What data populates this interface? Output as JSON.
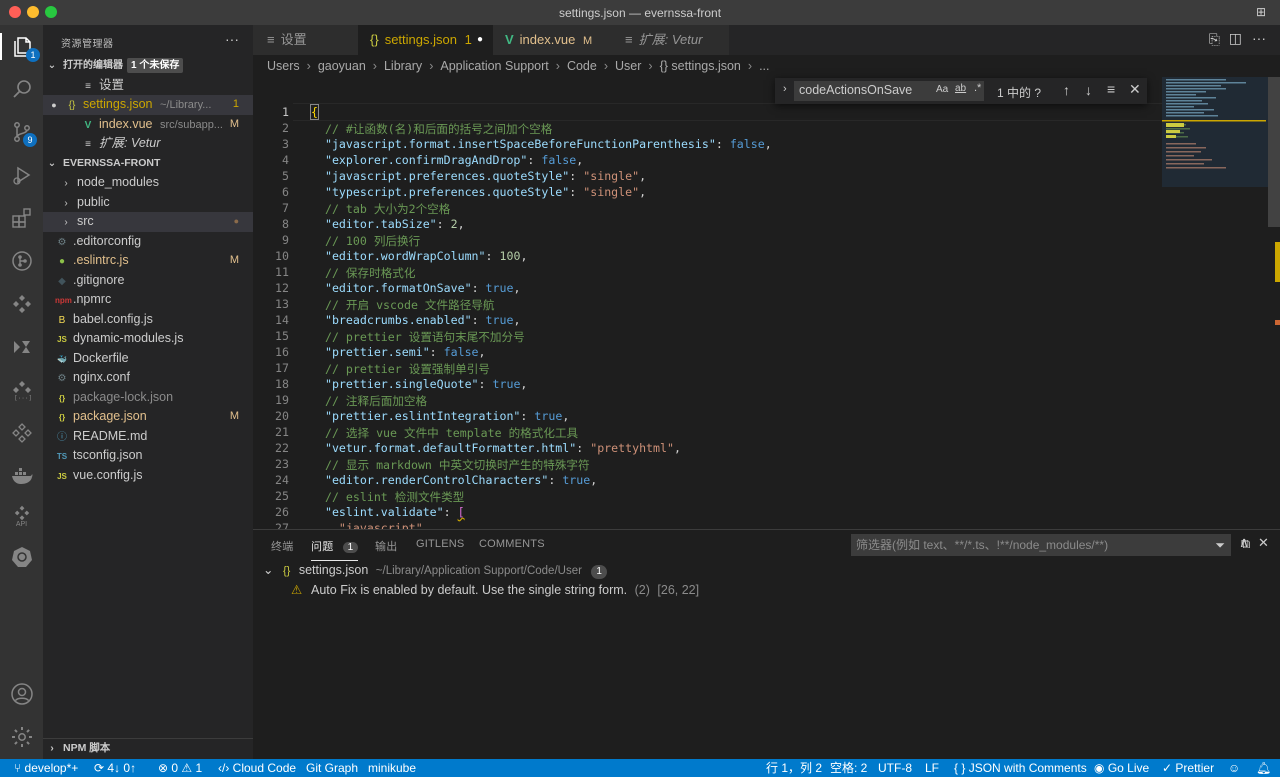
{
  "window": {
    "title": "settings.json — evernssa-front"
  },
  "activity_bar": {
    "explorer_badge": "1",
    "scm_badge": "9",
    "remote_api_label": "API"
  },
  "sidebar": {
    "title": "资源管理器",
    "more": "···",
    "open_editors": {
      "label": "打开的编辑器",
      "unsaved_badge": "1 个未保存",
      "items": [
        {
          "icon": "≡",
          "label": "设置",
          "path": "",
          "status": ""
        },
        {
          "icon": "{}",
          "label": "settings.json",
          "path": "~/Library...",
          "status": "1"
        },
        {
          "icon": "V",
          "label": "index.vue",
          "path": "src/subapp...",
          "status": "M"
        },
        {
          "icon": "≡",
          "label": "扩展: Vetur",
          "path": "",
          "status": ""
        }
      ]
    },
    "project": {
      "label": "EVERNSSA-FRONT",
      "items": [
        {
          "icon": "›",
          "label": "node_modules",
          "status": ""
        },
        {
          "icon": "›",
          "label": "public",
          "status": ""
        },
        {
          "icon": "›",
          "label": "src",
          "status": "●"
        },
        {
          "icon": "⚙",
          "label": ".editorconfig",
          "status": ""
        },
        {
          "icon": "●",
          "label": ".eslintrc.js",
          "status": "M"
        },
        {
          "icon": "◆",
          "label": ".gitignore",
          "status": ""
        },
        {
          "icon": "npm",
          "label": ".npmrc",
          "status": ""
        },
        {
          "icon": "B",
          "label": "babel.config.js",
          "status": ""
        },
        {
          "icon": "JS",
          "label": "dynamic-modules.js",
          "status": ""
        },
        {
          "icon": "🐳",
          "label": "Dockerfile",
          "status": ""
        },
        {
          "icon": "⚙",
          "label": "nginx.conf",
          "status": ""
        },
        {
          "icon": "{}",
          "label": "package-lock.json",
          "status": ""
        },
        {
          "icon": "{}",
          "label": "package.json",
          "status": "M"
        },
        {
          "icon": "ⓘ",
          "label": "README.md",
          "status": ""
        },
        {
          "icon": "TS",
          "label": "tsconfig.json",
          "status": ""
        },
        {
          "icon": "JS",
          "label": "vue.config.js",
          "status": ""
        }
      ]
    },
    "npm_scripts": "NPM 脚本"
  },
  "tabs": [
    {
      "icon": "≡",
      "label": "设置",
      "suffix": ""
    },
    {
      "icon": "{}",
      "label": "settings.json",
      "suffix": "1"
    },
    {
      "icon": "V",
      "label": "index.vue",
      "suffix": "M"
    },
    {
      "icon": "≡",
      "label": "扩展: Vetur",
      "suffix": ""
    }
  ],
  "breadcrumb": [
    "Users",
    "gaoyuan",
    "Library",
    "Application Support",
    "Code",
    "User",
    "{} settings.json",
    "..."
  ],
  "find_widget": {
    "query": "codeActionsOnSave",
    "opt_case": "Aa",
    "opt_word": "ab",
    "opt_regex": ".*",
    "result": "1 中的 ?"
  },
  "editor": {
    "lines": [
      {
        "n": "1",
        "html": "<span style='color:#ffd700;outline:1px solid #888'>{</span>"
      },
      {
        "n": "2",
        "html": "  <span class='c'>// #让函数(名)和后面的括号之间加个空格</span>"
      },
      {
        "n": "3",
        "html": "  <span class='k'>\"javascript.format.insertSpaceBeforeFunctionParenthesis\"</span>: <span class='b'>false</span>,"
      },
      {
        "n": "4",
        "html": "  <span class='k'>\"explorer.confirmDragAndDrop\"</span>: <span class='b'>false</span>,"
      },
      {
        "n": "5",
        "html": "  <span class='k'>\"javascript.preferences.quoteStyle\"</span>: <span class='s'>\"single\"</span>,"
      },
      {
        "n": "6",
        "html": "  <span class='k'>\"typescript.preferences.quoteStyle\"</span>: <span class='s'>\"single\"</span>,"
      },
      {
        "n": "7",
        "html": "  <span class='c'>// tab 大小为2个空格</span>"
      },
      {
        "n": "8",
        "html": "  <span class='k'>\"editor.tabSize\"</span>: <span class='n'>2</span>,"
      },
      {
        "n": "9",
        "html": "  <span class='c'>// 100 列后换行</span>"
      },
      {
        "n": "10",
        "html": "  <span class='k'>\"editor.wordWrapColumn\"</span>: <span class='n'>100</span>,"
      },
      {
        "n": "11",
        "html": "  <span class='c'>// 保存时格式化</span>"
      },
      {
        "n": "12",
        "html": "  <span class='k'>\"editor.formatOnSave\"</span>: <span class='b'>true</span>,"
      },
      {
        "n": "13",
        "html": "  <span class='c'>// 开启 vscode 文件路径导航</span>"
      },
      {
        "n": "14",
        "html": "  <span class='k'>\"breadcrumbs.enabled\"</span>: <span class='b'>true</span>,"
      },
      {
        "n": "15",
        "html": "  <span class='c'>// prettier 设置语句末尾不加分号</span>"
      },
      {
        "n": "16",
        "html": "  <span class='k'>\"prettier.semi\"</span>: <span class='b'>false</span>,"
      },
      {
        "n": "17",
        "html": "  <span class='c'>// prettier 设置强制单引号</span>"
      },
      {
        "n": "18",
        "html": "  <span class='k'>\"prettier.singleQuote\"</span>: <span class='b'>true</span>,"
      },
      {
        "n": "19",
        "html": "  <span class='c'>// 注释后面加空格</span>"
      },
      {
        "n": "20",
        "html": "  <span class='k'>\"prettier.eslintIntegration\"</span>: <span class='b'>true</span>,"
      },
      {
        "n": "21",
        "html": "  <span class='c'>// 选择 vue 文件中 template 的格式化工具</span>"
      },
      {
        "n": "22",
        "html": "  <span class='k'>\"vetur.format.defaultFormatter.html\"</span>: <span class='s'>\"prettyhtml\"</span>,"
      },
      {
        "n": "23",
        "html": "  <span class='c'>// 显示 markdown 中英文切换时产生的特殊字符</span>"
      },
      {
        "n": "24",
        "html": "  <span class='k'>\"editor.renderControlCharacters\"</span>: <span class='b'>true</span>,"
      },
      {
        "n": "25",
        "html": "  <span class='c'>// eslint 检测文件类型</span>"
      },
      {
        "n": "26",
        "html": "  <span class='k'>\"eslint.validate\"</span>: <span style='color:#da70d6;text-decoration:underline wavy #cca700'>[</span>"
      },
      {
        "n": "27",
        "html": "    <span class='s'>\"javascript\"</span>,"
      }
    ]
  },
  "panel": {
    "tabs": [
      {
        "label": "终端"
      },
      {
        "label": "问题",
        "badge": "1"
      },
      {
        "label": "输出"
      },
      {
        "label": "GITLENS"
      },
      {
        "label": "COMMENTS"
      }
    ],
    "filter_placeholder": "筛选器(例如 text、**/*.ts、!**/node_modules/**)",
    "problem_file": {
      "name": "settings.json",
      "path": "~/Library/Application Support/Code/User",
      "count": "1"
    },
    "problem": {
      "message": "Auto Fix is enabled by default. Use the single string form.",
      "count": "(2)",
      "location": "[26, 22]"
    }
  },
  "statusbar": {
    "branch": "develop*+",
    "sync": "4↓ 0↑",
    "errors": "0",
    "warnings": "1",
    "cloud_code": "Cloud Code",
    "git_graph": "Git Graph",
    "minikube": "minikube",
    "position": "行 1，列 2",
    "spaces": "空格: 2",
    "encoding": "UTF-8",
    "eol": "LF",
    "language": "JSON with Comments",
    "go_live": "Go Live",
    "prettier": "Prettier"
  },
  "colors": {
    "accent": "#007acc",
    "modified": "#e2c08d",
    "warning": "#cca700"
  }
}
